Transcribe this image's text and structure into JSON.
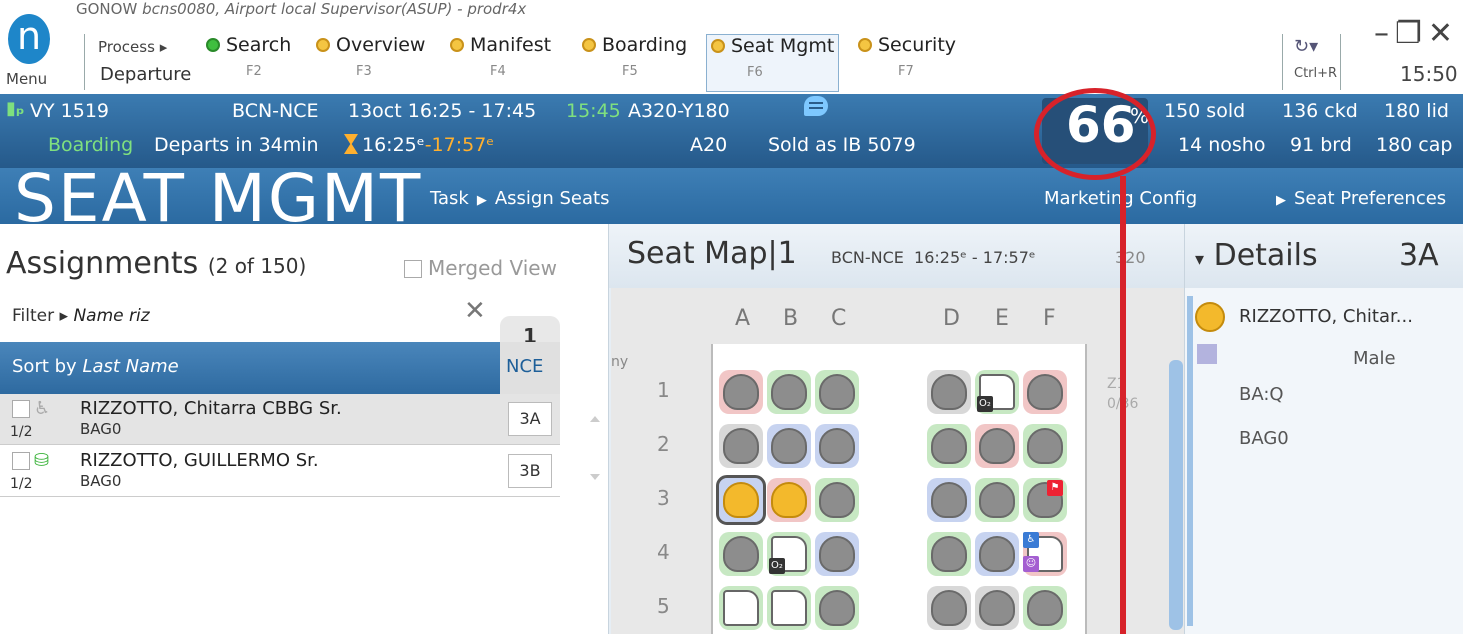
{
  "app": {
    "name": "GONOW",
    "subtitle": "bcns0080, Airport local Supervisor(ASUP) - prodr4x",
    "menu_label": "Menu",
    "logo_letter": "n"
  },
  "process": {
    "label": "Process",
    "departure": "Departure"
  },
  "nav": [
    {
      "label": "Search",
      "fkey": "F2",
      "dot": "green"
    },
    {
      "label": "Overview",
      "fkey": "F3",
      "dot": "orange"
    },
    {
      "label": "Manifest",
      "fkey": "F4",
      "dot": "orange"
    },
    {
      "label": "Boarding",
      "fkey": "F5",
      "dot": "orange"
    },
    {
      "label": "Seat Mgmt",
      "fkey": "F6",
      "dot": "orange",
      "active": true
    },
    {
      "label": "Security",
      "fkey": "F7",
      "dot": "orange"
    }
  ],
  "toolbar": {
    "refresh_shortcut": "Ctrl+R",
    "clock": "15:50"
  },
  "flight": {
    "carrier_flight": "VY 1519",
    "route": "BCN-NCE",
    "date_time": "13oct 16:25 - 17:45",
    "actual_time": "15:45",
    "aircraft": "A320-Y180",
    "status": "Boarding",
    "departs_in": "Departs in 34min",
    "sched_time": "16:25ᵉ",
    "est_time": "-17:57ᵉ",
    "gate": "A20",
    "sold_as": "Sold as IB 5079",
    "load_pct": "66",
    "pct_sign": "%",
    "sold": "150 sold",
    "ckd": "136 ckd",
    "lid": "180 lid",
    "nosho": "14 nosho",
    "brd": "91 brd",
    "cap": "180 cap",
    "colors": {
      "band": "#2b6aa1",
      "green": "#7fe07f",
      "orange": "#ffb02e"
    }
  },
  "page": {
    "title": "SEAT MGMT",
    "task": "Task",
    "assign_seats": "Assign Seats",
    "marketing_config": "Marketing Config",
    "seat_preferences": "Seat Preferences"
  },
  "assignments": {
    "title": "Assignments",
    "count": "(2 of 150)",
    "merged_view": "Merged View",
    "filter_label": "Filter",
    "filter_value": "Name riz",
    "sort_label": "Sort by",
    "sort_value": "Last Name",
    "column": {
      "number": "1",
      "code": "NCE"
    },
    "rows": [
      {
        "name": "RIZZOTTO, Chitarra CBBG Sr.",
        "bag": "BAG0",
        "frac": "1/2",
        "seat": "3A",
        "icon": "infant-icon",
        "selected": true
      },
      {
        "name": "RIZZOTTO, GUILLERMO Sr.",
        "bag": "BAG0",
        "frac": "1/2",
        "seat": "3B",
        "icon": "seated-passenger-icon",
        "selected": false
      }
    ]
  },
  "seatmap": {
    "title": "Seat Map|1",
    "route": "BCN-NCE",
    "times": "16:25ᵉ - 17:57ᵉ",
    "aircraft_short": "320",
    "ny_label": "ny",
    "columns_left": [
      "A",
      "B",
      "C"
    ],
    "columns_right": [
      "D",
      "E",
      "F"
    ],
    "row_numbers": [
      "1",
      "2",
      "3",
      "4",
      "5"
    ],
    "side_zone": "Z1",
    "side_count": "0/36",
    "oxygen_badge": "O₂"
  },
  "details": {
    "title": "Details",
    "seat": "3A",
    "name": "RIZZOTTO, Chitar...",
    "gender": "Male",
    "class": "BA:Q",
    "bag": "BAG0"
  },
  "annotation": {
    "color": "#d7222a"
  }
}
